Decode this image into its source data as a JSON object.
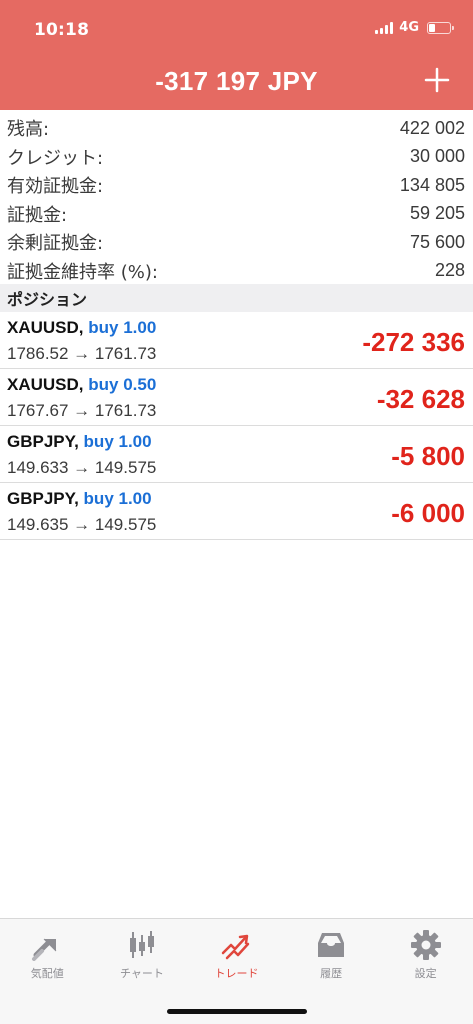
{
  "status_bar": {
    "time": "10:18",
    "network": "4G"
  },
  "header": {
    "title": "-317 197 JPY"
  },
  "summary": [
    {
      "label": "残高:",
      "value": "422 002"
    },
    {
      "label": "クレジット:",
      "value": "30 000"
    },
    {
      "label": "有効証拠金:",
      "value": "134 805"
    },
    {
      "label": "証拠金:",
      "value": "59 205"
    },
    {
      "label": "余剰証拠金:",
      "value": "75 600"
    },
    {
      "label": "証拠金維持率 (%):",
      "value": "228"
    }
  ],
  "positions_section": {
    "title": "ポジション"
  },
  "positions": [
    {
      "symbol": "XAUUSD,",
      "type": "buy 1.00",
      "prices": "1786.52 → 1761.73",
      "profit": "-272 336"
    },
    {
      "symbol": "XAUUSD,",
      "type": "buy 0.50",
      "prices": "1767.67 → 1761.73",
      "profit": "-32 628"
    },
    {
      "symbol": "GBPJPY,",
      "type": "buy 1.00",
      "prices": "149.633 → 149.575",
      "profit": "-5 800"
    },
    {
      "symbol": "GBPJPY,",
      "type": "buy 1.00",
      "prices": "149.635 → 149.575",
      "profit": "-6 000"
    }
  ],
  "tabbar": {
    "items": [
      {
        "label": "気配値",
        "icon": "quotes-icon"
      },
      {
        "label": "チャート",
        "icon": "candlestick-icon"
      },
      {
        "label": "トレード",
        "icon": "trade-icon"
      },
      {
        "label": "履歴",
        "icon": "history-tray-icon"
      },
      {
        "label": "設定",
        "icon": "gear-icon"
      }
    ],
    "active": "トレード"
  },
  "colors": {
    "header": "#e56a62",
    "loss": "#e0241b",
    "buy": "#1b6fd6",
    "tab_active": "#e0463c",
    "tab_inactive": "#8e8e93"
  }
}
